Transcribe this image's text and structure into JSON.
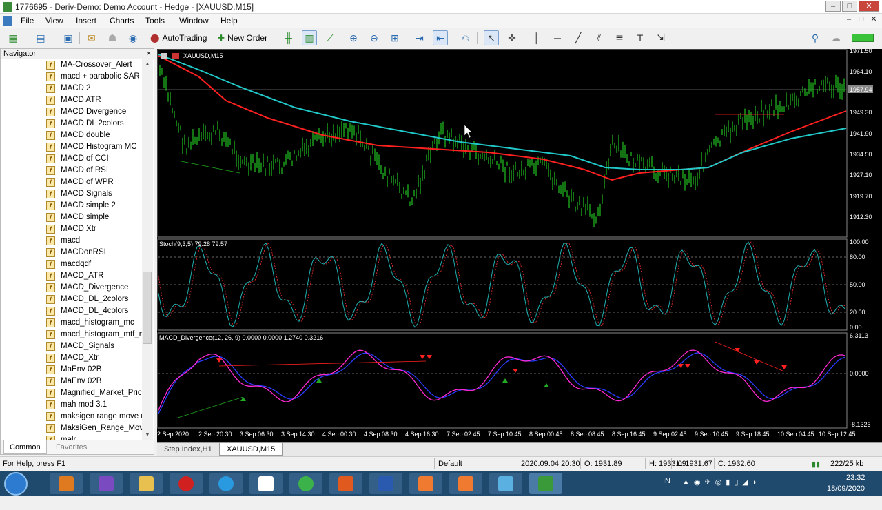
{
  "titlebar": {
    "title": "1776695 - Deriv-Demo: Demo Account - Hedge - [XAUUSD,M15]",
    "min": "–",
    "max": "□",
    "close": "✕"
  },
  "menubar": {
    "items": [
      "File",
      "View",
      "Insert",
      "Charts",
      "Tools",
      "Window",
      "Help"
    ]
  },
  "toolbar": {
    "autotrading": "AutoTrading",
    "new_order": "New Order"
  },
  "navigator": {
    "title": "Navigator",
    "close": "×",
    "items": [
      "MA-Crossover_Alert",
      "macd + parabolic SAR",
      "MACD 2",
      "MACD ATR",
      "MACD Divergence",
      "MACD DL 2colors",
      "MACD double",
      "MACD Histogram MC",
      "MACD of CCI",
      "MACD of RSI",
      "MACD of WPR",
      "MACD Signals",
      "MACD simple 2",
      "MACD simple",
      "MACD Xtr",
      "macd",
      "MACDonRSI",
      "macdqdf",
      "MACD_ATR",
      "MACD_Divergence",
      "MACD_DL_2colors",
      "MACD_DL_4colors",
      "macd_histogram_mc",
      "macd_histogram_mtf_m",
      "MACD_Signals",
      "MACD_Xtr",
      "MaEnv 02B",
      "MaEnv 02B",
      "Magnified_Market_Price",
      "mah mod 3.1",
      "maksigen range move r",
      "MaksiGen_Range_Move",
      "malr"
    ],
    "tabs": {
      "common": "Common",
      "favorites": "Favorites"
    }
  },
  "chart": {
    "symbol_label": "XAUUSD,M15",
    "price_axis": [
      "1971.50",
      "1964.10",
      "1957.94",
      "1949.30",
      "1941.90",
      "1934.50",
      "1927.10",
      "1919.70",
      "1912.30"
    ],
    "current_price": "1957.94",
    "stoch_label": "Stoch(9,3,5) 79.28 79.57",
    "stoch_axis": [
      "100.00",
      "80.00",
      "50.00",
      "20.00",
      "0.00"
    ],
    "macd_label": "MACD_Divergence(12, 26, 9) 0.0000 0.0000 1.2740 0.3216",
    "macd_axis": [
      "6.3113",
      "0.0000",
      "-8.1326"
    ],
    "time_axis": [
      "2 Sep 2020",
      "2 Sep 20:30",
      "3 Sep 06:30",
      "3 Sep 14:30",
      "4 Sep 00:30",
      "4 Sep 08:30",
      "4 Sep 16:30",
      "7 Sep 02:45",
      "7 Sep 10:45",
      "8 Sep 00:45",
      "8 Sep 08:45",
      "8 Sep 16:45",
      "9 Sep 02:45",
      "9 Sep 10:45",
      "9 Sep 18:45",
      "10 Sep 04:45",
      "10 Sep 12:45"
    ],
    "colors": {
      "candles": "#22c322",
      "ma_fast": "#ff2020",
      "ma_slow": "#20c8c8",
      "stoch_main": "#20b0b0",
      "stoch_signal": "#ff3030",
      "macd_main": "#ff2ad4",
      "macd_signal": "#2a3cff",
      "arrow_down": "#ff2020",
      "arrow_up": "#22aa22"
    }
  },
  "charttabs": [
    "Step Index,H1",
    "XAUUSD,M15"
  ],
  "status": {
    "help": "For Help, press F1",
    "profile": "Default",
    "time": "2020.09.04 20:30",
    "open": "O: 1931.89",
    "high": "H: 1933.09",
    "low": "L: 1931.67",
    "close": "C: 1932.60",
    "traffic": "222/25 kb"
  },
  "taskbar": {
    "lang": "IN",
    "time": "23:32",
    "date": "18/09/2020"
  }
}
